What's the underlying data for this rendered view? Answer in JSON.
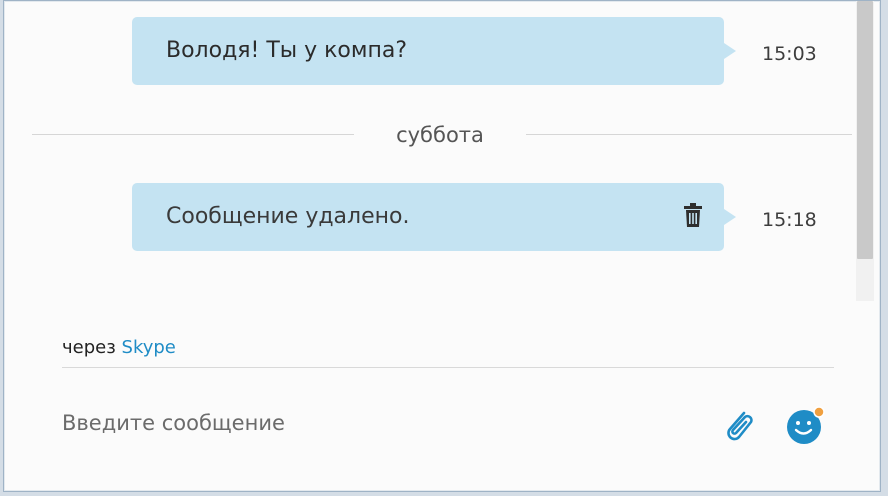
{
  "messages": [
    {
      "text": "Володя! Ты у компа?",
      "time": "15:03",
      "deleted": false
    },
    {
      "text": "Сообщение удалено.",
      "time": "15:18",
      "deleted": true
    }
  ],
  "day_divider": "суббота",
  "via": {
    "prefix": "через",
    "service": "Skype"
  },
  "composer": {
    "placeholder": "Введите сообщение"
  },
  "icons": {
    "delete": "trash-icon",
    "attach": "paperclip-icon",
    "emoticon": "smiley-icon"
  },
  "colors": {
    "bubble": "#c4e3f2",
    "accent": "#1f8cc6",
    "emoticon_badge": "#f0a040"
  }
}
